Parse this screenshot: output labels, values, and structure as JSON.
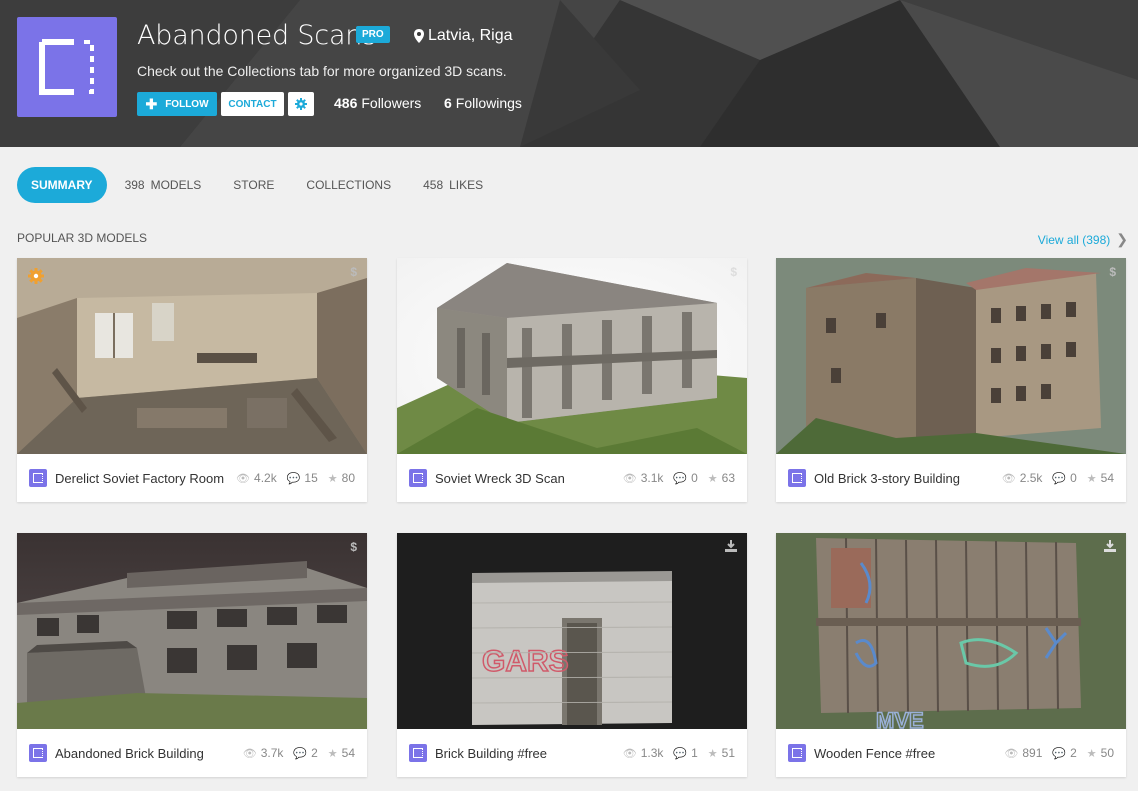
{
  "profile": {
    "name": "Abandoned Scans",
    "badge": "PRO",
    "location": "Latvia, Riga",
    "bio": "Check out the Collections tab for more organized 3D scans.",
    "follow_label": "FOLLOW",
    "contact_label": "CONTACT",
    "followers_count": "486",
    "followers_label": "Followers",
    "followings_count": "6",
    "followings_label": "Followings"
  },
  "tabs": {
    "summary": "SUMMARY",
    "models_count": "398",
    "models_label": "MODELS",
    "store": "STORE",
    "collections": "COLLECTIONS",
    "likes_count": "458",
    "likes_label": "LIKES"
  },
  "section": {
    "title": "POPULAR 3D MODELS",
    "view_all": "View all (398)"
  },
  "models": [
    {
      "title": "Derelict Soviet Factory Room",
      "views": "4.2k",
      "comments": "15",
      "likes": "80",
      "corner": "$"
    },
    {
      "title": "Soviet Wreck 3D Scan",
      "views": "3.1k",
      "comments": "0",
      "likes": "63",
      "corner": "$"
    },
    {
      "title": "Old Brick 3-story Building",
      "views": "2.5k",
      "comments": "0",
      "likes": "54",
      "corner": "$"
    },
    {
      "title": "Abandoned Brick Building",
      "views": "3.7k",
      "comments": "2",
      "likes": "54",
      "corner": "$"
    },
    {
      "title": "Brick Building #free",
      "views": "1.3k",
      "comments": "1",
      "likes": "51",
      "corner": "download"
    },
    {
      "title": "Wooden Fence #free",
      "views": "891",
      "comments": "2",
      "likes": "50",
      "corner": "download"
    }
  ],
  "colors": {
    "accent": "#1caad9",
    "avatar": "#7b73e8",
    "header_bg": "#3a3a3a",
    "staff_pick": "#f0a030"
  }
}
